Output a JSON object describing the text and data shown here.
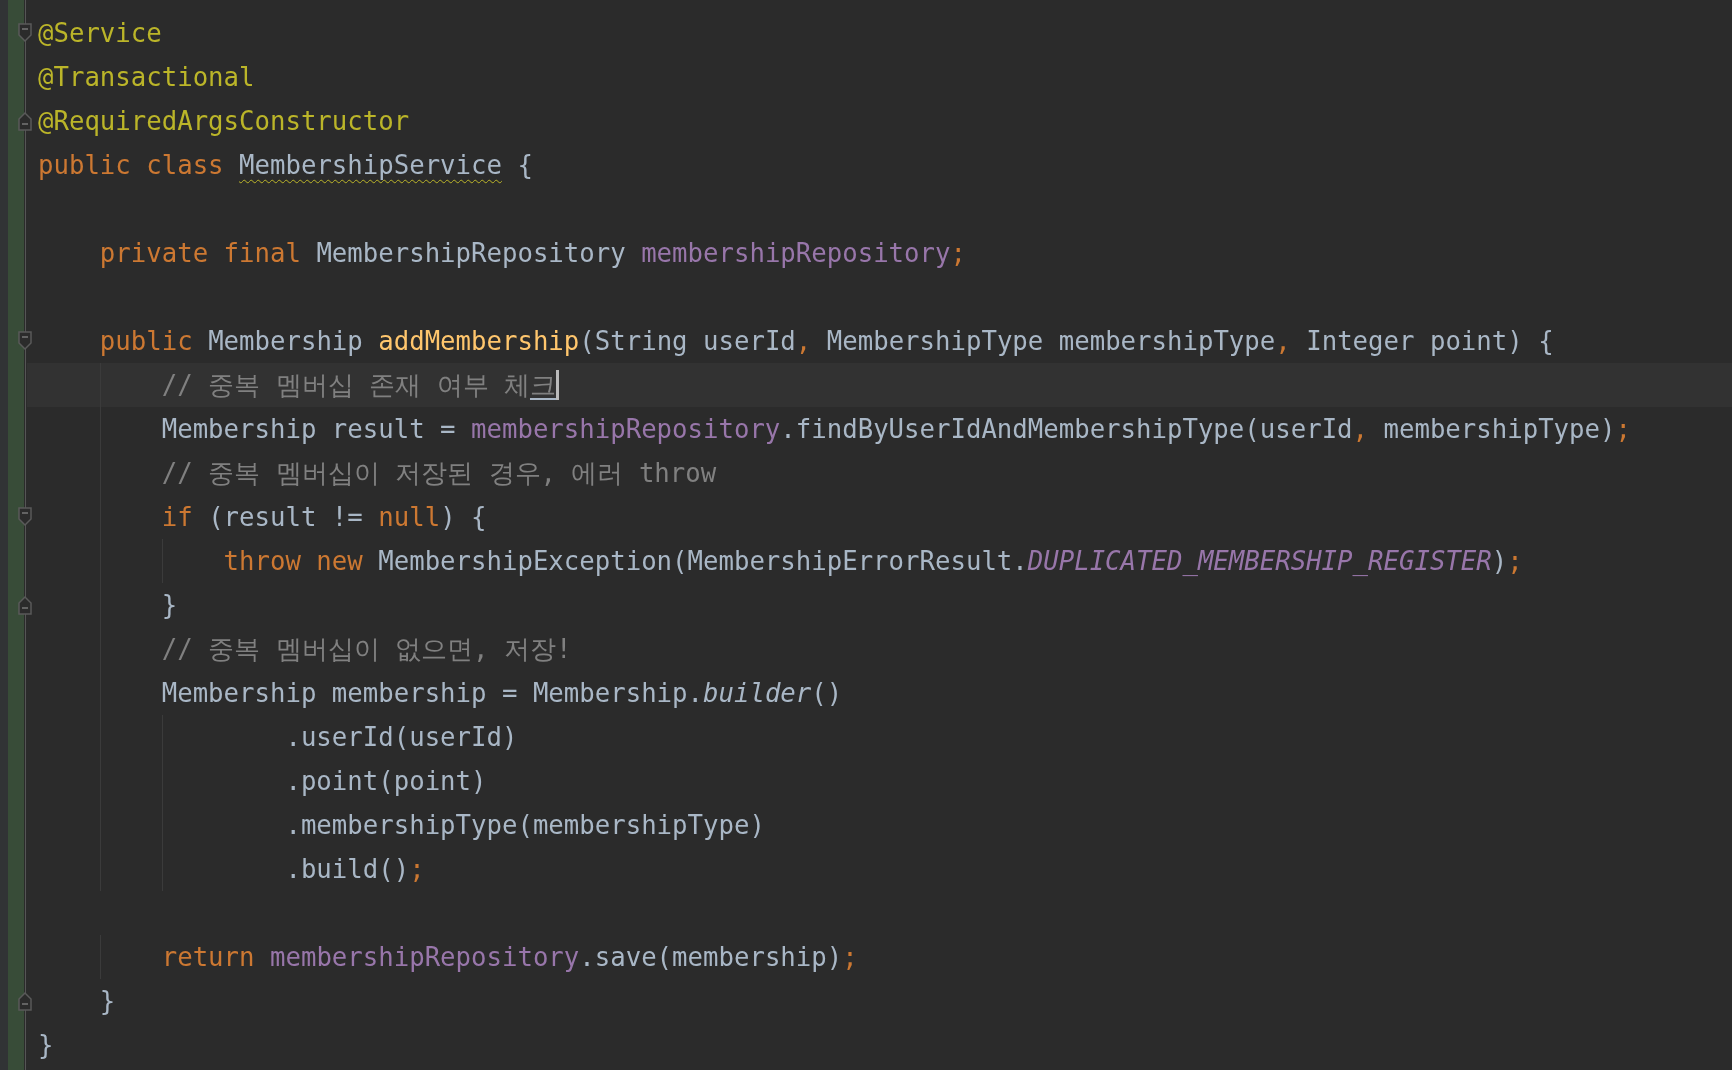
{
  "editor": {
    "lines": [
      {
        "fold_start": true,
        "fold_end": false,
        "current": false,
        "tokens": [
          {
            "text": "@Service",
            "kind": "annotation"
          }
        ]
      },
      {
        "fold_start": false,
        "fold_end": false,
        "current": false,
        "tokens": [
          {
            "text": "@Transactional",
            "kind": "annotation"
          }
        ]
      },
      {
        "fold_start": false,
        "fold_end": true,
        "current": false,
        "tokens": [
          {
            "text": "@RequiredArgsConstructor",
            "kind": "annotation"
          }
        ]
      },
      {
        "fold_start": false,
        "fold_end": false,
        "current": false,
        "tokens": [
          {
            "text": "public class ",
            "kind": "keyword"
          },
          {
            "text": "MembershipService",
            "kind": "plain",
            "warning": true
          },
          {
            "text": " {",
            "kind": "plain"
          }
        ]
      },
      {
        "fold_start": false,
        "fold_end": false,
        "current": false
      },
      {
        "fold_start": false,
        "fold_end": false,
        "current": false,
        "tokens": [
          {
            "text": "    private final ",
            "kind": "keyword"
          },
          {
            "text": "MembershipRepository ",
            "kind": "plain"
          },
          {
            "text": "membershipRepository",
            "kind": "field"
          },
          {
            "text": ";",
            "kind": "keyword"
          }
        ]
      },
      {
        "fold_start": false,
        "fold_end": false,
        "current": false
      },
      {
        "fold_start": true,
        "fold_end": false,
        "current": false,
        "tokens": [
          {
            "text": "    public ",
            "kind": "keyword"
          },
          {
            "text": "Membership ",
            "kind": "plain"
          },
          {
            "text": "addMembership",
            "kind": "method"
          },
          {
            "text": "(String userId",
            "kind": "plain"
          },
          {
            "text": ", ",
            "kind": "keyword"
          },
          {
            "text": "MembershipType membershipType",
            "kind": "plain"
          },
          {
            "text": ", ",
            "kind": "keyword"
          },
          {
            "text": "Integer point) {",
            "kind": "plain"
          }
        ]
      },
      {
        "fold_start": false,
        "fold_end": false,
        "current": true,
        "tokens": [
          {
            "text": "        // 중복 멤버십 존재 여부 체",
            "kind": "comment"
          },
          {
            "text": "크",
            "kind": "comment",
            "composing": true
          }
        ]
      },
      {
        "fold_start": false,
        "fold_end": false,
        "current": false,
        "tokens": [
          {
            "text": "        Membership result = ",
            "kind": "plain"
          },
          {
            "text": "membershipRepository",
            "kind": "field"
          },
          {
            "text": ".findByUserIdAndMembershipType(userId",
            "kind": "plain"
          },
          {
            "text": ", ",
            "kind": "keyword"
          },
          {
            "text": "membershipType)",
            "kind": "plain"
          },
          {
            "text": ";",
            "kind": "keyword"
          }
        ]
      },
      {
        "fold_start": false,
        "fold_end": false,
        "current": false,
        "tokens": [
          {
            "text": "        // 중복 멤버십이 저장된 경우, 에러 throw",
            "kind": "comment"
          }
        ]
      },
      {
        "fold_start": true,
        "fold_end": false,
        "current": false,
        "tokens": [
          {
            "text": "        if ",
            "kind": "keyword"
          },
          {
            "text": "(result != ",
            "kind": "plain"
          },
          {
            "text": "null",
            "kind": "keyword"
          },
          {
            "text": ") {",
            "kind": "plain"
          }
        ]
      },
      {
        "fold_start": false,
        "fold_end": false,
        "current": false,
        "tokens": [
          {
            "text": "            throw new ",
            "kind": "keyword"
          },
          {
            "text": "MembershipException(MembershipErrorResult.",
            "kind": "plain"
          },
          {
            "text": "DUPLICATED_MEMBERSHIP_REGISTER",
            "kind": "constant"
          },
          {
            "text": ")",
            "kind": "plain"
          },
          {
            "text": ";",
            "kind": "keyword"
          }
        ]
      },
      {
        "fold_start": false,
        "fold_end": true,
        "current": false,
        "tokens": [
          {
            "text": "        }",
            "kind": "plain"
          }
        ]
      },
      {
        "fold_start": false,
        "fold_end": false,
        "current": false,
        "tokens": [
          {
            "text": "        // 중복 멤버십이 없으면, 저장!",
            "kind": "comment"
          }
        ]
      },
      {
        "fold_start": false,
        "fold_end": false,
        "current": false,
        "tokens": [
          {
            "text": "        Membership membership = Membership.",
            "kind": "plain"
          },
          {
            "text": "builder",
            "kind": "static-call"
          },
          {
            "text": "()",
            "kind": "plain"
          }
        ]
      },
      {
        "fold_start": false,
        "fold_end": false,
        "current": false,
        "tokens": [
          {
            "text": "                .userId(userId)",
            "kind": "plain"
          }
        ]
      },
      {
        "fold_start": false,
        "fold_end": false,
        "current": false,
        "tokens": [
          {
            "text": "                .point(point)",
            "kind": "plain"
          }
        ]
      },
      {
        "fold_start": false,
        "fold_end": false,
        "current": false,
        "tokens": [
          {
            "text": "                .membershipType(membershipType)",
            "kind": "plain"
          }
        ]
      },
      {
        "fold_start": false,
        "fold_end": false,
        "current": false,
        "tokens": [
          {
            "text": "                .build()",
            "kind": "plain"
          },
          {
            "text": ";",
            "kind": "keyword"
          }
        ]
      },
      {
        "fold_start": false,
        "fold_end": false,
        "current": false
      },
      {
        "fold_start": false,
        "fold_end": false,
        "current": false,
        "tokens": [
          {
            "text": "        return ",
            "kind": "keyword"
          },
          {
            "text": "membershipRepository",
            "kind": "field"
          },
          {
            "text": ".save(membership)",
            "kind": "plain"
          },
          {
            "text": ";",
            "kind": "keyword"
          }
        ]
      },
      {
        "fold_start": false,
        "fold_end": true,
        "current": false,
        "tokens": [
          {
            "text": "    }",
            "kind": "plain"
          }
        ]
      },
      {
        "fold_start": false,
        "fold_end": false,
        "current": false,
        "tokens": [
          {
            "text": "}",
            "kind": "plain"
          }
        ]
      }
    ]
  }
}
